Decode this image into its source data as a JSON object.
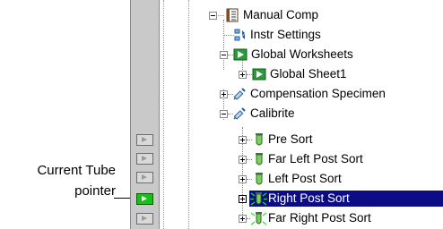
{
  "callout": {
    "line1": "Current Tube",
    "line2": "pointer"
  },
  "tree": {
    "root": "Manual Comp",
    "items": [
      {
        "label": "Instr Settings"
      },
      {
        "label": "Global Worksheets"
      },
      {
        "label": "Global Sheet1"
      },
      {
        "label": "Compensation Specimen"
      },
      {
        "label": "Calibrite"
      },
      {
        "label": "Pre Sort"
      },
      {
        "label": "Far Left Post Sort"
      },
      {
        "label": "Left Post Sort"
      },
      {
        "label": "Right Post Sort"
      },
      {
        "label": "Far Right Post Sort"
      }
    ],
    "selected": "Right Post Sort",
    "current_tube": "Right Post Sort"
  },
  "icons": {
    "root": "worksheet-book-icon",
    "instr": "instrument-settings-icon",
    "worksheets": "worksheet-icon",
    "specimen": "syringe-icon",
    "tube": "test-tube-icon"
  }
}
